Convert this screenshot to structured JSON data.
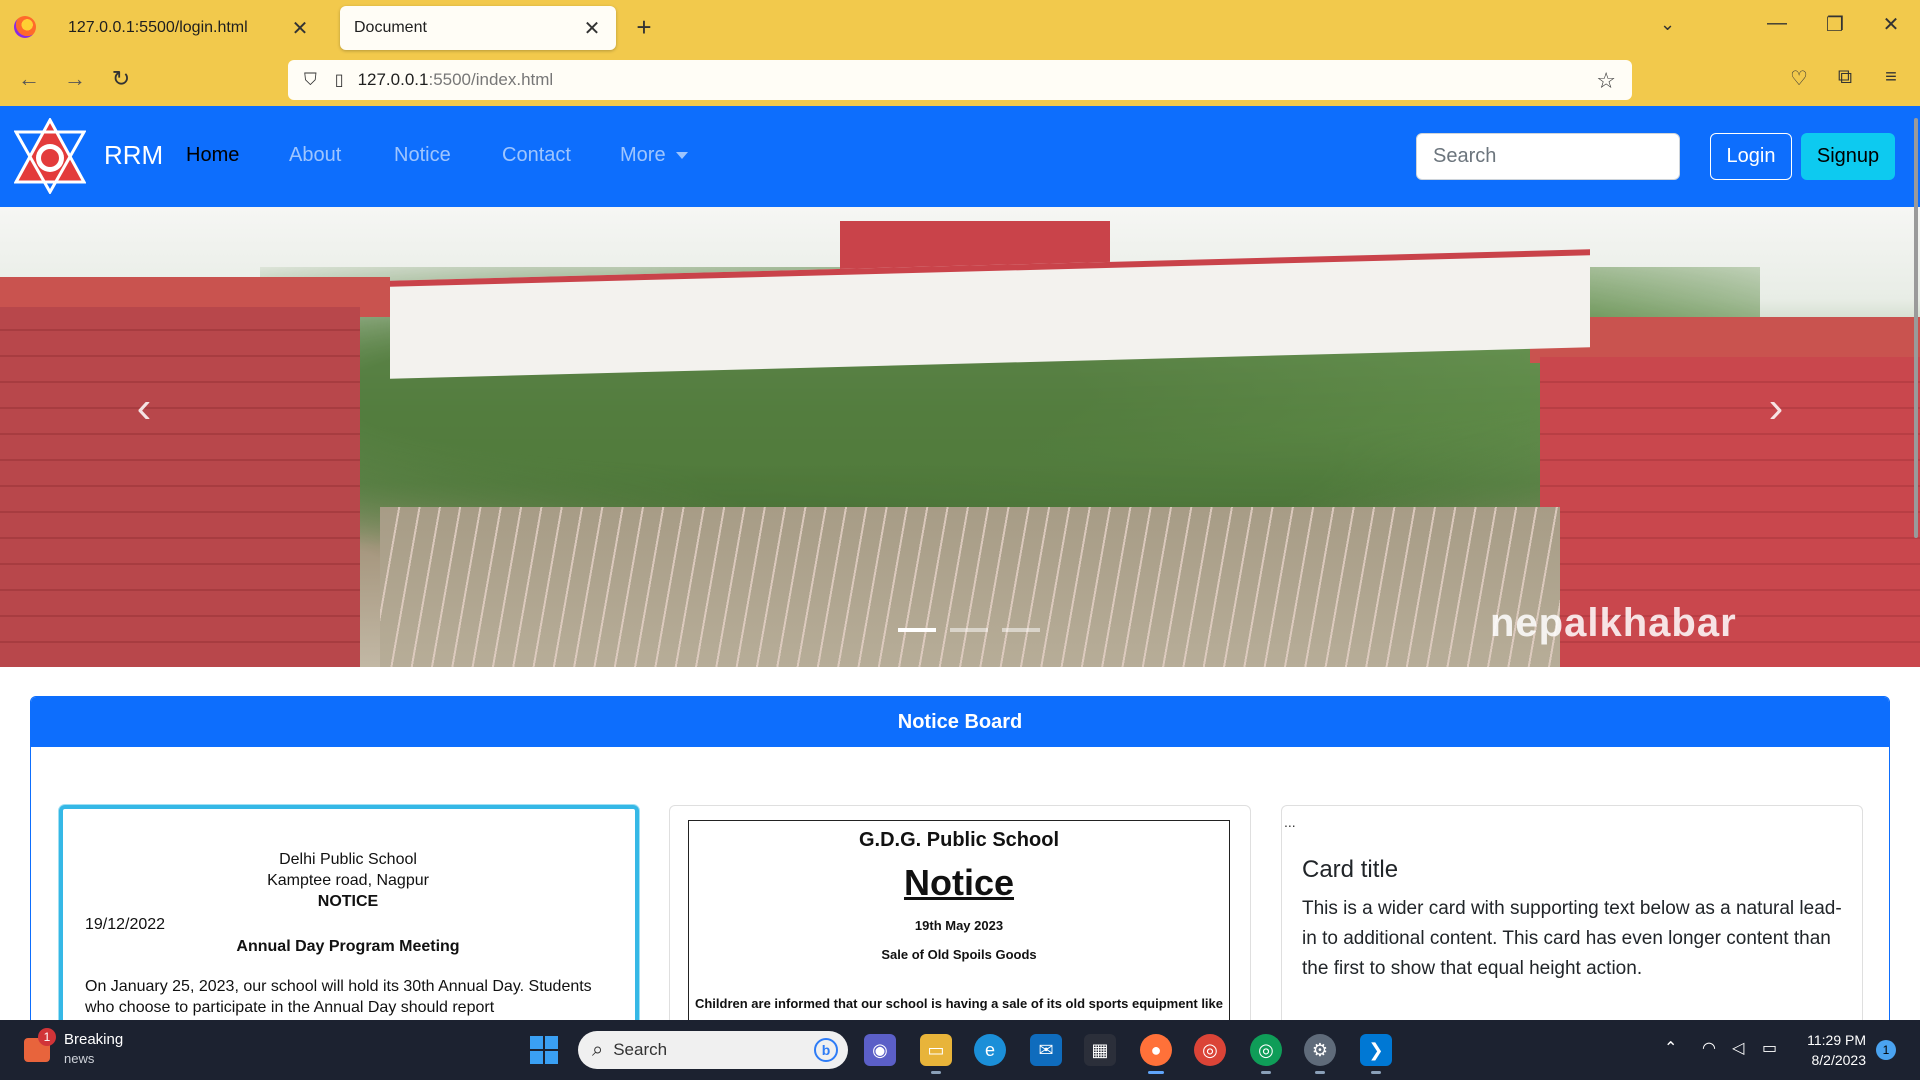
{
  "browser": {
    "tabs": [
      {
        "title": "127.0.0.1:5500/login.html",
        "active": false
      },
      {
        "title": "Document",
        "active": true
      }
    ],
    "url_host": "127.0.0.1",
    "url_rest": ":5500/index.html"
  },
  "site": {
    "brand": "RRM",
    "nav": [
      "Home",
      "About",
      "Notice",
      "Contact",
      "More"
    ],
    "search_placeholder": "Search",
    "login_label": "Login",
    "signup_label": "Signup"
  },
  "carousel": {
    "watermark": "nepalkhabar",
    "slide_count": 3,
    "active_slide": 1
  },
  "notice_board": {
    "title": "Notice Board",
    "card1": {
      "school": "Delhi Public School",
      "address": "Kamptee road, Nagpur",
      "heading": "NOTICE",
      "date": "19/12/2022",
      "title": "Annual Day Program Meeting",
      "body": "On January 25, 2023, our school will hold its 30th Annual Day. Students who choose to participate in the Annual Day should report"
    },
    "card2": {
      "school": "G.D.G. Public School",
      "heading": "Notice",
      "date": "19th May 2023",
      "subject": "Sale of Old Spoils Goods",
      "body": "Children are informed that our school is having a sale of its old sports equipment like"
    },
    "card3": {
      "broken_image": "...",
      "title": "Card title",
      "text": "This is a wider card with supporting text below as a natural lead-in to additional content. This card has even longer content than the first to show that equal height action."
    }
  },
  "taskbar": {
    "news_title": "Breaking",
    "news_sub": "news",
    "news_badge": "1",
    "search_placeholder": "Search",
    "time": "11:29 PM",
    "date": "8/2/2023",
    "notification_count": "1"
  }
}
